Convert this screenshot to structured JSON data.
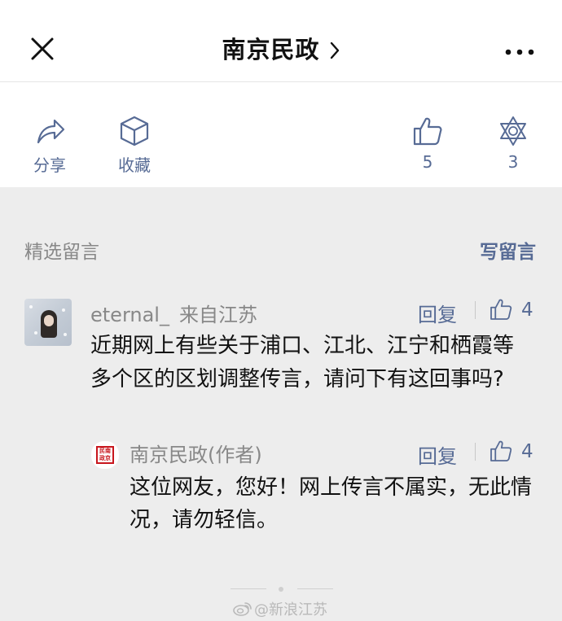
{
  "header": {
    "title": "南京民政",
    "close_icon": "close-icon",
    "more_icon": "more-icon",
    "chevron_icon": "chevron-right-icon"
  },
  "actions": {
    "share_label": "分享",
    "favorite_label": "收藏",
    "like_count": "5",
    "wow_count": "3"
  },
  "comments_section": {
    "title": "精选留言",
    "write_label": "写留言"
  },
  "comment": {
    "user": "eternal_",
    "location": "来自江苏",
    "reply_label": "回复",
    "likes": "4",
    "text": "近期网上有些关于浦口、江北、江宁和栖霞等多个区的区划调整传言，请问下有这回事吗?"
  },
  "author_reply": {
    "name": "南京民政(作者)",
    "reply_label": "回复",
    "likes": "4",
    "text": "这位网友，您好！网上传言不属实，无此情况，请勿轻信。",
    "seal_text": "民南政京"
  },
  "watermark": "@新浪江苏",
  "colors": {
    "accent": "#576b95",
    "muted": "#888888",
    "background": "#ededed"
  }
}
